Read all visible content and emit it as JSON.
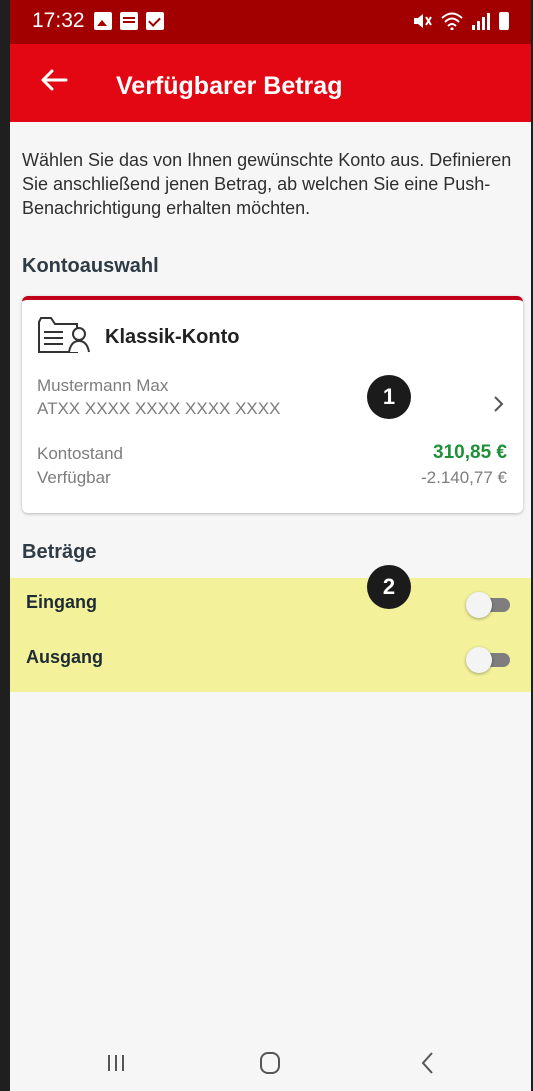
{
  "statusbar": {
    "time": "17:32",
    "icons_left": [
      "image-icon",
      "message-icon",
      "checkbox-icon"
    ],
    "icons_right": [
      "mute-icon",
      "wifi-icon",
      "signal-icon",
      "battery-icon"
    ]
  },
  "appbar": {
    "title": "Verfügbarer Betrag",
    "back_icon": "back-arrow-icon"
  },
  "intro_text": "Wählen Sie das von Ihnen gewünschte Konto aus. Definieren Sie anschließend jenen Betrag, ab welchen Sie eine Push-Benachrichtigung erhalten möchten.",
  "section_accounts": "Kontoauswahl",
  "account": {
    "name": "Klassik-Konto",
    "owner": "Mustermann Max",
    "iban": "ATXX XXXX XXXX XXXX XXXX",
    "balance_label": "Kontostand",
    "balance_value": "310,85 €",
    "available_label": "Verfügbar",
    "available_value": "-2.140,77 €"
  },
  "section_amounts": "Beträge",
  "toggles": [
    {
      "label": "Eingang",
      "on": false
    },
    {
      "label": "Ausgang",
      "on": false
    }
  ],
  "badges": [
    "1",
    "2"
  ],
  "colors": {
    "brand_red": "#e30613",
    "status_red": "#a20000",
    "balance_green": "#1f8f3a",
    "highlight_yellow": "#f3f29b"
  },
  "navbar": {
    "icons": [
      "recent-apps-icon",
      "home-icon",
      "back-icon"
    ]
  }
}
